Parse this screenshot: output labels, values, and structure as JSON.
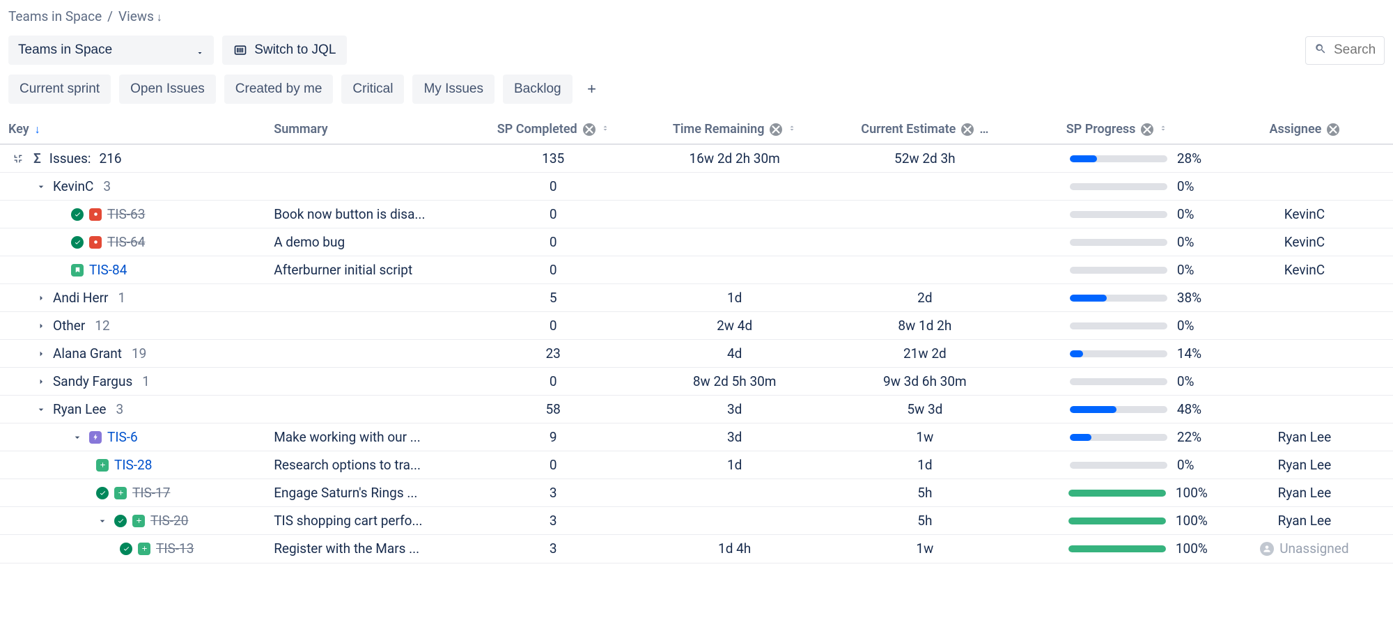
{
  "breadcrumb": {
    "root": "Teams in Space",
    "sep": "/",
    "current": "Views"
  },
  "filters": {
    "project_dropdown": "Teams in Space",
    "jql_button": "Switch to JQL",
    "search_placeholder": "Search"
  },
  "chips": [
    "Current sprint",
    "Open Issues",
    "Created by me",
    "Critical",
    "My Issues",
    "Backlog"
  ],
  "columns": {
    "key": "Key",
    "summary": "Summary",
    "sp_completed": "SP Completed",
    "time_remaining": "Time Remaining",
    "current_estimate": "Current Estimate",
    "more": "…",
    "sp_progress": "SP Progress",
    "assignee": "Assignee"
  },
  "totals": {
    "label": "Issues:",
    "count": "216",
    "sp_completed": "135",
    "time_remaining": "16w 2d 2h 30m",
    "current_estimate": "52w 2d 3h",
    "progress_pct": "28%",
    "progress_fill": 28
  },
  "rows": [
    {
      "type": "group",
      "expanded": true,
      "indent": 1,
      "label": "KevinC",
      "count": "3",
      "sp": "0",
      "time": "",
      "est": "",
      "pct": "0%",
      "fill": 0
    },
    {
      "type": "issue",
      "indent": 2,
      "done": true,
      "badge": "bug",
      "key": "TIS-63",
      "strike": true,
      "summary": "Book now button is disa...",
      "sp": "0",
      "time": "",
      "est": "",
      "pct": "0%",
      "fill": 0,
      "assignee": "KevinC"
    },
    {
      "type": "issue",
      "indent": 2,
      "done": true,
      "badge": "bug",
      "key": "TIS-64",
      "strike": true,
      "summary": "A demo bug",
      "sp": "0",
      "time": "",
      "est": "",
      "pct": "0%",
      "fill": 0,
      "assignee": "KevinC"
    },
    {
      "type": "issue",
      "indent": 2,
      "done": false,
      "badge": "story",
      "key": "TIS-84",
      "strike": false,
      "summary": "Afterburner initial script",
      "sp": "0",
      "time": "",
      "est": "",
      "pct": "0%",
      "fill": 0,
      "assignee": "KevinC"
    },
    {
      "type": "group",
      "expanded": false,
      "indent": 1,
      "label": "Andi Herr",
      "count": "1",
      "sp": "5",
      "time": "1d",
      "est": "2d",
      "pct": "38%",
      "fill": 38
    },
    {
      "type": "group",
      "expanded": false,
      "indent": 1,
      "label": "Other",
      "count": "12",
      "sp": "0",
      "time": "2w 4d",
      "est": "8w 1d 2h",
      "pct": "0%",
      "fill": 0
    },
    {
      "type": "group",
      "expanded": false,
      "indent": 1,
      "label": "Alana Grant",
      "count": "19",
      "sp": "23",
      "time": "4d",
      "est": "21w 2d",
      "pct": "14%",
      "fill": 14
    },
    {
      "type": "group",
      "expanded": false,
      "indent": 1,
      "label": "Sandy Fargus",
      "count": "1",
      "sp": "0",
      "time": "8w 2d 5h 30m",
      "est": "9w 3d 6h 30m",
      "pct": "0%",
      "fill": 0
    },
    {
      "type": "group",
      "expanded": true,
      "indent": 1,
      "label": "Ryan Lee",
      "count": "3",
      "sp": "58",
      "time": "3d",
      "est": "5w 3d",
      "pct": "48%",
      "fill": 48
    },
    {
      "type": "issue",
      "indent": 2,
      "expander": true,
      "expanded": true,
      "done": false,
      "badge": "epic",
      "key": "TIS-6",
      "strike": false,
      "summary": "Make working with our ...",
      "sp": "9",
      "time": "3d",
      "est": "1w",
      "pct": "22%",
      "fill": 22,
      "assignee": "Ryan Lee"
    },
    {
      "type": "issue",
      "indent": 3,
      "done": false,
      "badge": "imp",
      "key": "TIS-28",
      "strike": false,
      "summary": "Research options to tra...",
      "sp": "0",
      "time": "1d",
      "est": "1d",
      "pct": "0%",
      "fill": 0,
      "assignee": "Ryan Lee"
    },
    {
      "type": "issue",
      "indent": 3,
      "done": true,
      "badge": "imp",
      "key": "TIS-17",
      "strike": true,
      "summary": "Engage Saturn's Rings ...",
      "sp": "3",
      "time": "",
      "est": "5h",
      "pct": "100%",
      "fill": 100,
      "green": true,
      "assignee": "Ryan Lee"
    },
    {
      "type": "issue",
      "indent": 3,
      "expander": true,
      "expanded": true,
      "done": true,
      "badge": "imp",
      "key": "TIS-20",
      "strike": true,
      "summary": "TIS shopping cart perfo...",
      "sp": "3",
      "time": "",
      "est": "5h",
      "pct": "100%",
      "fill": 100,
      "green": true,
      "assignee": "Ryan Lee"
    },
    {
      "type": "issue",
      "indent": 4,
      "done": true,
      "badge": "imp",
      "key": "TIS-13",
      "strike": true,
      "summary": "Register with the Mars ...",
      "sp": "3",
      "time": "1d 4h",
      "est": "1w",
      "pct": "100%",
      "fill": 100,
      "green": true,
      "assignee": "Unassigned",
      "unassigned": true
    }
  ]
}
